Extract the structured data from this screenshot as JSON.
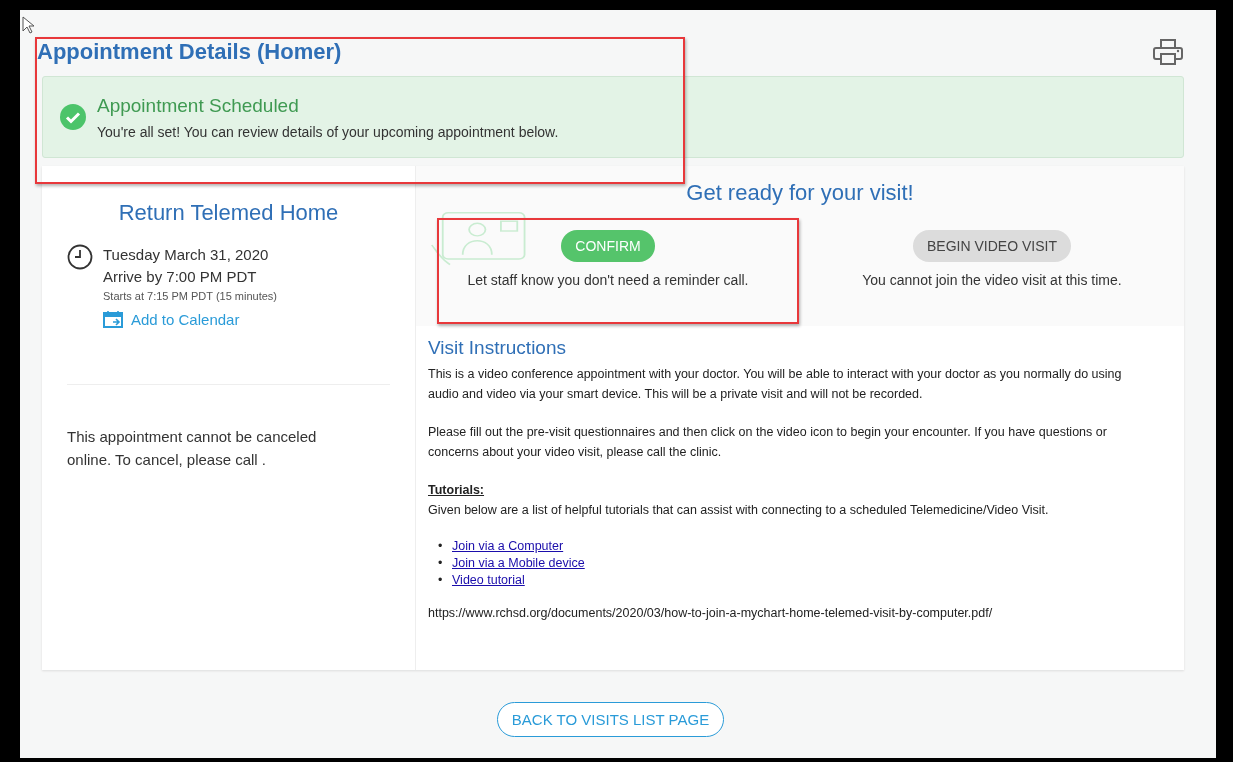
{
  "page_title": "Appointment Details (Homer)",
  "banner": {
    "title": "Appointment Scheduled",
    "message": "You're all set! You can review details of your upcoming appointment below."
  },
  "summary": {
    "heading": "Return Telemed Home",
    "date": "Tuesday March 31, 2020",
    "arrive": "Arrive by 7:00 PM PDT",
    "starts": "Starts at 7:15 PM PDT (15 minutes)",
    "calendar_link": "Add to Calendar",
    "cancel_note": "This appointment cannot be canceled online. To cancel, please call ."
  },
  "get_ready": {
    "heading": "Get ready for your visit!",
    "actions": [
      {
        "label": "CONFIRM",
        "caption": "Let staff know you don't need a reminder call.",
        "disabled": false
      },
      {
        "label": "BEGIN VIDEO VISIT",
        "caption": "You cannot join the video visit at this time.",
        "disabled": true
      }
    ]
  },
  "instructions": {
    "heading": "Visit Instructions",
    "paragraphs": [
      "This is a video conference appointment with your doctor. You will be able to interact with your doctor as you normally do using audio and video via your smart device. This will be a private visit and will not be recorded.",
      "Please fill out the pre-visit questionnaires and then click on the video icon to begin your encounter. If you have questions or concerns about your video visit, please call the clinic."
    ],
    "tutorials_heading": "Tutorials:",
    "tutorials_intro": "Given below are a list of helpful tutorials that can assist with connecting to a scheduled Telemedicine/Video Visit.",
    "links": [
      {
        "bullet": "•",
        "label": "Join via a Computer"
      },
      {
        "bullet": "•",
        "label": "Join via a Mobile device"
      },
      {
        "bullet": "•",
        "label": "Video tutorial"
      }
    ],
    "url": "https://www.rchsd.org/documents/2020/03/how-to-join-a-mychart-home-telemed-visit-by-computer.pdf/"
  },
  "back_button": "BACK TO VISITS LIST PAGE"
}
